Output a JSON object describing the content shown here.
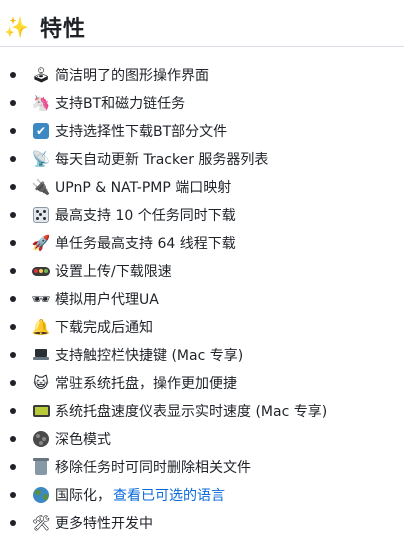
{
  "heading": {
    "icon": "sparkles-icon",
    "icon_glyph": "✨",
    "title": "特性"
  },
  "features": [
    {
      "icon": "joystick-icon",
      "glyph": "🕹",
      "text": "简洁明了的图形操作界面"
    },
    {
      "icon": "unicorn-icon",
      "glyph": "🦄",
      "text": "支持BT和磁力链任务"
    },
    {
      "icon": "check-box-icon",
      "glyph": "✔",
      "text": "支持选择性下载BT部分文件"
    },
    {
      "icon": "satellite-antenna-icon",
      "glyph": "📡",
      "text": "每天自动更新 Tracker 服务器列表"
    },
    {
      "icon": "plug-icon",
      "glyph": "🔌",
      "text": "UPnP & NAT-PMP 端口映射"
    },
    {
      "icon": "dice-icon",
      "glyph": "⚄",
      "text": "最高支持 10 个任务同时下载"
    },
    {
      "icon": "rocket-icon",
      "glyph": "🚀",
      "text": "单任务最高支持 64 线程下载"
    },
    {
      "icon": "traffic-light-icon",
      "glyph": "🚥",
      "text": "设置上传/下载限速"
    },
    {
      "icon": "sunglasses-icon",
      "glyph": "🕶",
      "text": "模拟用户代理UA"
    },
    {
      "icon": "bell-icon",
      "glyph": "🔔",
      "text": "下载完成后通知"
    },
    {
      "icon": "laptop-icon",
      "glyph": "💻",
      "text": "支持触控栏快捷键 (Mac 专享)"
    },
    {
      "icon": "tray-mascot-icon",
      "glyph": "😺",
      "text": "常驻系统托盘，操作更加便捷"
    },
    {
      "icon": "lcd-display-icon",
      "glyph": "📟",
      "text": "系统托盘速度仪表显示实时速度 (Mac 专享)"
    },
    {
      "icon": "dark-ball-icon",
      "glyph": "⚫",
      "text": "深色模式"
    },
    {
      "icon": "trash-bin-icon",
      "glyph": "🗑",
      "text": "移除任务时可同时删除相关文件"
    },
    {
      "icon": "globe-icon",
      "glyph": "🌏",
      "text": "国际化，",
      "link": "查看已可选的语言"
    },
    {
      "icon": "tools-icon",
      "glyph": "🛠",
      "text": "更多特性开发中"
    }
  ],
  "colors": {
    "text": "#1f2328",
    "link": "#0969da",
    "divider": "#d8dee4"
  }
}
